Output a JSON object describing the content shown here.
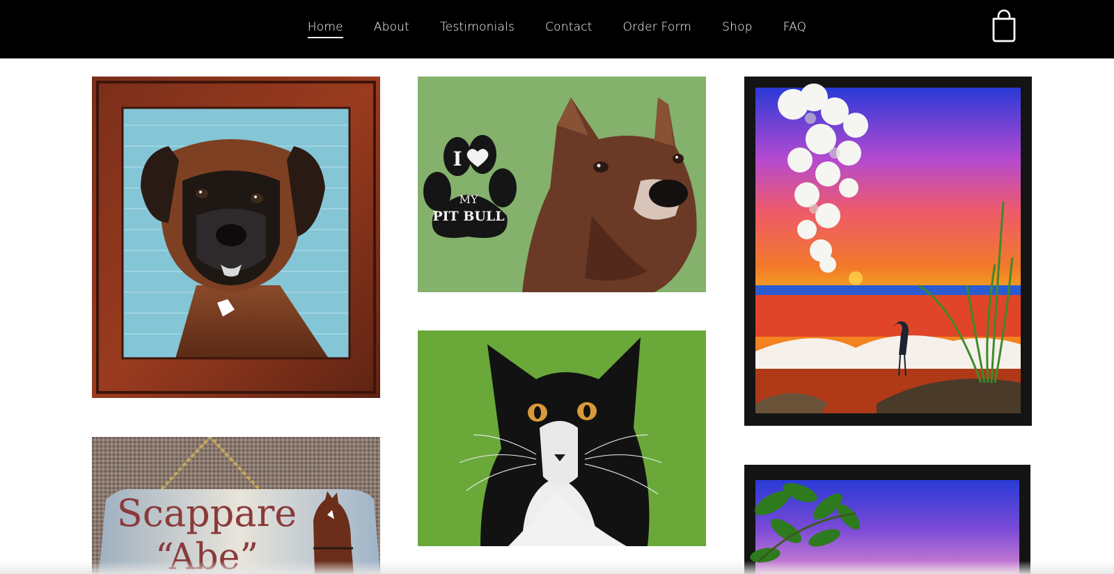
{
  "header": {
    "nav": [
      {
        "label": "Home",
        "active": true
      },
      {
        "label": "About",
        "active": false
      },
      {
        "label": "Testimonials",
        "active": false
      },
      {
        "label": "Contact",
        "active": false
      },
      {
        "label": "Order Form",
        "active": false
      },
      {
        "label": "Shop",
        "active": false
      },
      {
        "label": "FAQ",
        "active": false
      }
    ],
    "cart_icon": "shopping-bag-icon"
  },
  "gallery": {
    "paw_text": {
      "line1": "I",
      "line2": "MY",
      "line3": "PIT BULL"
    },
    "sign_text": {
      "line1": "Scappare",
      "line2": "“Abe”"
    }
  }
}
